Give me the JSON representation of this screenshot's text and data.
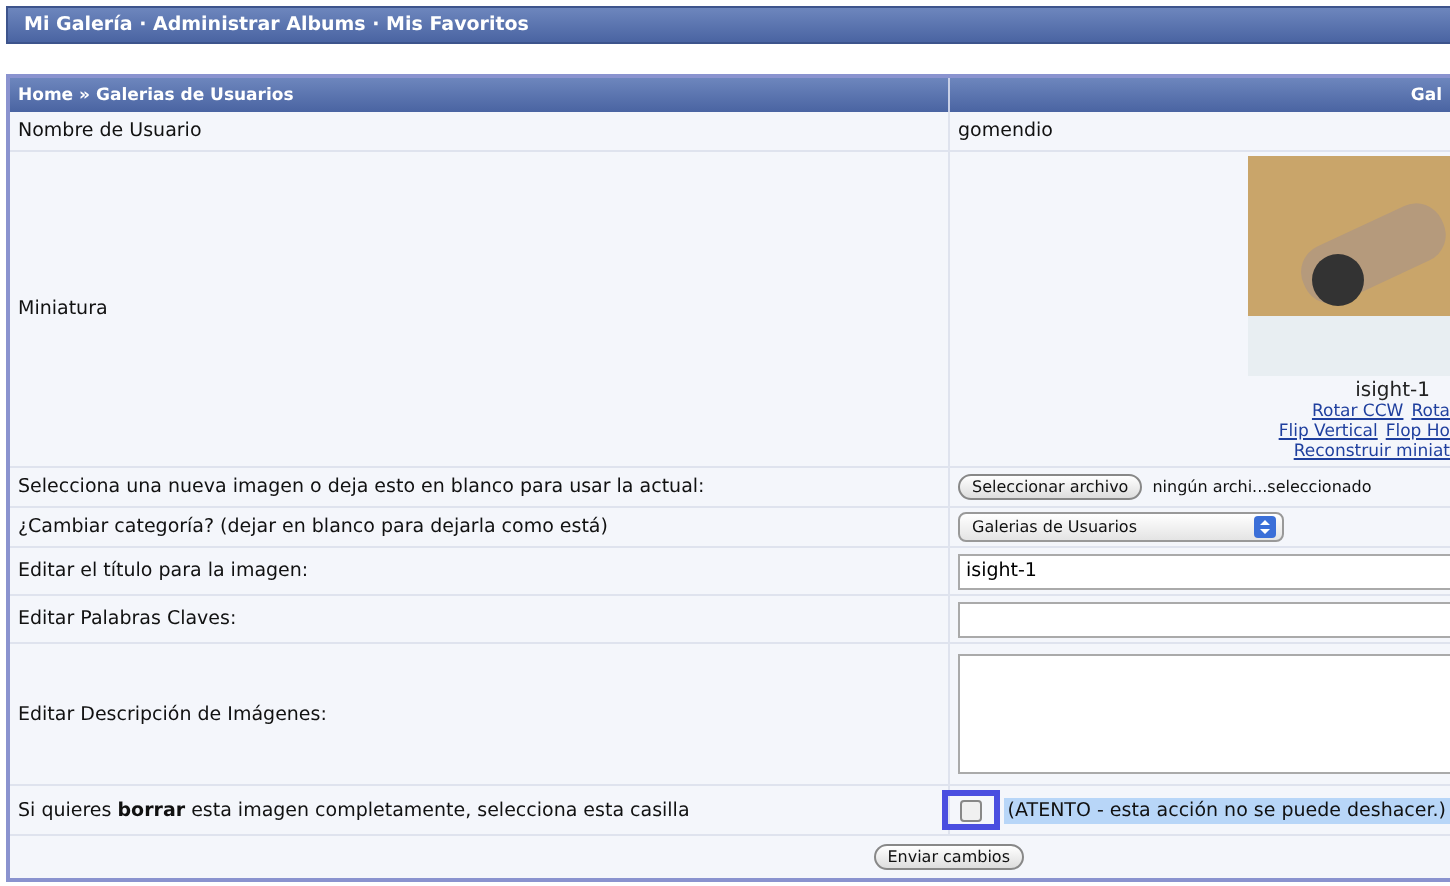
{
  "top_bar": {
    "title": "Mi Galería · Administrar Albums · Mis Favoritos"
  },
  "table": {
    "breadcrumb": "Home » Galerias de Usuarios",
    "header_right": "Gal",
    "rows": [
      {
        "kind": "text",
        "label": "Nombre de Usuario",
        "value": "gomendio"
      },
      {
        "kind": "thumbnail",
        "label": "Miniatura",
        "caption": "isight-1",
        "links": [
          [
            "Rotar CCW",
            "Rota"
          ],
          [
            "Flip Vertical",
            "Flop Ho"
          ],
          [
            "Reconstruir miniat"
          ]
        ]
      },
      {
        "kind": "file",
        "label": "Selecciona una nueva imagen o deja esto en blanco para usar la actual:",
        "button": "Seleccionar archivo",
        "value": "ningún archi...seleccionado"
      },
      {
        "kind": "select",
        "label": "¿Cambiar categoría? (dejar en blanco para dejarla como está)",
        "value": "Galerias de Usuarios"
      },
      {
        "kind": "input",
        "label": "Editar el título para la imagen:",
        "value": "isight-1"
      },
      {
        "kind": "input",
        "label": "Editar Palabras Claves:",
        "value": ""
      },
      {
        "kind": "textarea",
        "label": "Editar Descripción de Imágenes:",
        "value": ""
      },
      {
        "kind": "checkbox",
        "label": "Si quieres **borrar** esta imagen completamente, selecciona esta casilla",
        "checked": false,
        "highlighted": true,
        "note": "(ATENTO - esta acción no se puede deshacer.)"
      }
    ],
    "submit": "Enviar cambios"
  }
}
